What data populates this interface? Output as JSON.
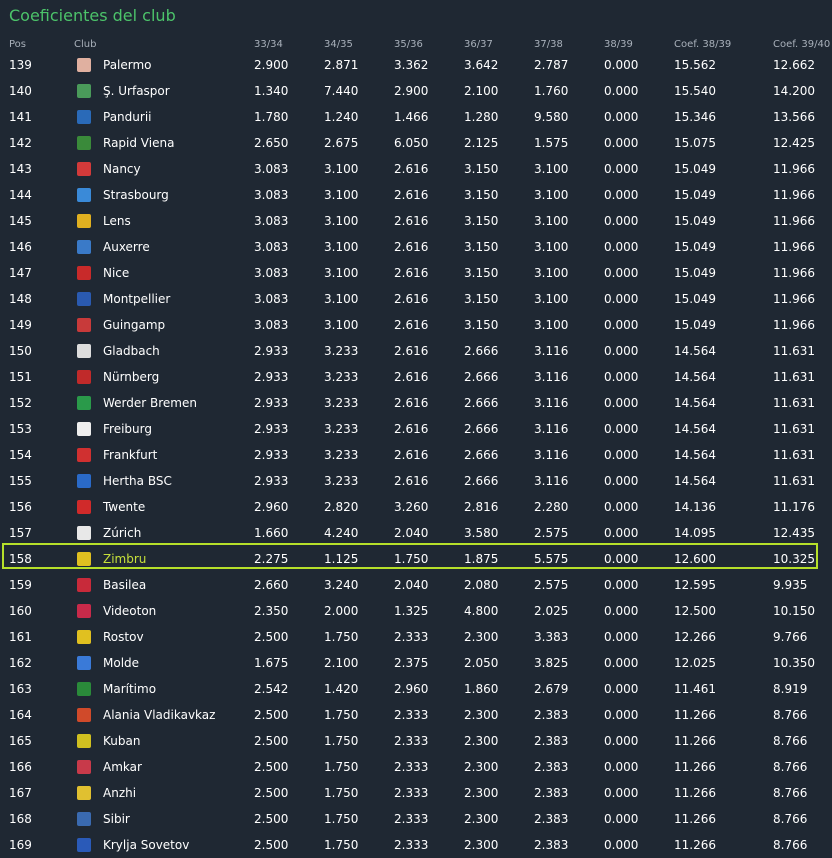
{
  "title": "Coeficientes del club",
  "headers": [
    "Pos",
    "Club",
    "33/34",
    "34/35",
    "35/36",
    "36/37",
    "37/38",
    "38/39",
    "Coef. 38/39",
    "Coef. 39/40"
  ],
  "colors": {
    "accent": "#4cc36a",
    "highlight": "#b6e02a",
    "background": "#1f2833"
  },
  "highlight_pos": "158",
  "rows": [
    {
      "pos": "139",
      "club": "Palermo",
      "badge": "#e0b0a0",
      "v": [
        "2.900",
        "2.871",
        "3.362",
        "3.642",
        "2.787",
        "0.000",
        "15.562",
        "12.662"
      ]
    },
    {
      "pos": "140",
      "club": "Ş. Urfaspor",
      "badge": "#4a9a5a",
      "v": [
        "1.340",
        "7.440",
        "2.900",
        "2.100",
        "1.760",
        "0.000",
        "15.540",
        "14.200"
      ]
    },
    {
      "pos": "141",
      "club": "Pandurii",
      "badge": "#2a6ab8",
      "v": [
        "1.780",
        "1.240",
        "1.466",
        "1.280",
        "9.580",
        "0.000",
        "15.346",
        "13.566"
      ]
    },
    {
      "pos": "142",
      "club": "Rapid Viena",
      "badge": "#3a8a3a",
      "v": [
        "2.650",
        "2.675",
        "6.050",
        "2.125",
        "1.575",
        "0.000",
        "15.075",
        "12.425"
      ]
    },
    {
      "pos": "143",
      "club": "Nancy",
      "badge": "#d23a3a",
      "v": [
        "3.083",
        "3.100",
        "2.616",
        "3.150",
        "3.100",
        "0.000",
        "15.049",
        "11.966"
      ]
    },
    {
      "pos": "144",
      "club": "Strasbourg",
      "badge": "#3a8ad8",
      "v": [
        "3.083",
        "3.100",
        "2.616",
        "3.150",
        "3.100",
        "0.000",
        "15.049",
        "11.966"
      ]
    },
    {
      "pos": "145",
      "club": "Lens",
      "badge": "#e0b020",
      "v": [
        "3.083",
        "3.100",
        "2.616",
        "3.150",
        "3.100",
        "0.000",
        "15.049",
        "11.966"
      ]
    },
    {
      "pos": "146",
      "club": "Auxerre",
      "badge": "#3a7ac8",
      "v": [
        "3.083",
        "3.100",
        "2.616",
        "3.150",
        "3.100",
        "0.000",
        "15.049",
        "11.966"
      ]
    },
    {
      "pos": "147",
      "club": "Nice",
      "badge": "#c82a2a",
      "v": [
        "3.083",
        "3.100",
        "2.616",
        "3.150",
        "3.100",
        "0.000",
        "15.049",
        "11.966"
      ]
    },
    {
      "pos": "148",
      "club": "Montpellier",
      "badge": "#2a5ab0",
      "v": [
        "3.083",
        "3.100",
        "2.616",
        "3.150",
        "3.100",
        "0.000",
        "15.049",
        "11.966"
      ]
    },
    {
      "pos": "149",
      "club": "Guingamp",
      "badge": "#c83a3a",
      "v": [
        "3.083",
        "3.100",
        "2.616",
        "3.150",
        "3.100",
        "0.000",
        "15.049",
        "11.966"
      ]
    },
    {
      "pos": "150",
      "club": "Gladbach",
      "badge": "#dddddd",
      "v": [
        "2.933",
        "3.233",
        "2.616",
        "2.666",
        "3.116",
        "0.000",
        "14.564",
        "11.631"
      ]
    },
    {
      "pos": "151",
      "club": "Nürnberg",
      "badge": "#c02a2a",
      "v": [
        "2.933",
        "3.233",
        "2.616",
        "2.666",
        "3.116",
        "0.000",
        "14.564",
        "11.631"
      ]
    },
    {
      "pos": "152",
      "club": "Werder Bremen",
      "badge": "#2a9a4a",
      "v": [
        "2.933",
        "3.233",
        "2.616",
        "2.666",
        "3.116",
        "0.000",
        "14.564",
        "11.631"
      ]
    },
    {
      "pos": "153",
      "club": "Freiburg",
      "badge": "#eeeeee",
      "v": [
        "2.933",
        "3.233",
        "2.616",
        "2.666",
        "3.116",
        "0.000",
        "14.564",
        "11.631"
      ]
    },
    {
      "pos": "154",
      "club": "Frankfurt",
      "badge": "#d03030",
      "v": [
        "2.933",
        "3.233",
        "2.616",
        "2.666",
        "3.116",
        "0.000",
        "14.564",
        "11.631"
      ]
    },
    {
      "pos": "155",
      "club": "Hertha BSC",
      "badge": "#2a6ac8",
      "v": [
        "2.933",
        "3.233",
        "2.616",
        "2.666",
        "3.116",
        "0.000",
        "14.564",
        "11.631"
      ]
    },
    {
      "pos": "156",
      "club": "Twente",
      "badge": "#d02a2a",
      "v": [
        "2.960",
        "2.820",
        "3.260",
        "2.816",
        "2.280",
        "0.000",
        "14.136",
        "11.176"
      ]
    },
    {
      "pos": "157",
      "club": "Zúrich",
      "badge": "#e8e8e8",
      "v": [
        "1.660",
        "4.240",
        "2.040",
        "3.580",
        "2.575",
        "0.000",
        "14.095",
        "12.435"
      ]
    },
    {
      "pos": "158",
      "club": "Zimbru",
      "badge": "#e0c020",
      "v": [
        "2.275",
        "1.125",
        "1.750",
        "1.875",
        "5.575",
        "0.000",
        "12.600",
        "10.325"
      ]
    },
    {
      "pos": "159",
      "club": "Basilea",
      "badge": "#c82a3a",
      "v": [
        "2.660",
        "3.240",
        "2.040",
        "2.080",
        "2.575",
        "0.000",
        "12.595",
        "9.935"
      ]
    },
    {
      "pos": "160",
      "club": "Videoton",
      "badge": "#c82a4a",
      "v": [
        "2.350",
        "2.000",
        "1.325",
        "4.800",
        "2.025",
        "0.000",
        "12.500",
        "10.150"
      ]
    },
    {
      "pos": "161",
      "club": "Rostov",
      "badge": "#e0c020",
      "v": [
        "2.500",
        "1.750",
        "2.333",
        "2.300",
        "3.383",
        "0.000",
        "12.266",
        "9.766"
      ]
    },
    {
      "pos": "162",
      "club": "Molde",
      "badge": "#3a7ad8",
      "v": [
        "1.675",
        "2.100",
        "2.375",
        "2.050",
        "3.825",
        "0.000",
        "12.025",
        "10.350"
      ]
    },
    {
      "pos": "163",
      "club": "Marítimo",
      "badge": "#2a8a3a",
      "v": [
        "2.542",
        "1.420",
        "2.960",
        "1.860",
        "2.679",
        "0.000",
        "11.461",
        "8.919"
      ]
    },
    {
      "pos": "164",
      "club": "Alania Vladikavkaz",
      "badge": "#d04a2a",
      "v": [
        "2.500",
        "1.750",
        "2.333",
        "2.300",
        "2.383",
        "0.000",
        "11.266",
        "8.766"
      ]
    },
    {
      "pos": "165",
      "club": "Kuban",
      "badge": "#d0c020",
      "v": [
        "2.500",
        "1.750",
        "2.333",
        "2.300",
        "2.383",
        "0.000",
        "11.266",
        "8.766"
      ]
    },
    {
      "pos": "166",
      "club": "Amkar",
      "badge": "#c83a4a",
      "v": [
        "2.500",
        "1.750",
        "2.333",
        "2.300",
        "2.383",
        "0.000",
        "11.266",
        "8.766"
      ]
    },
    {
      "pos": "167",
      "club": "Anzhi",
      "badge": "#e0c030",
      "v": [
        "2.500",
        "1.750",
        "2.333",
        "2.300",
        "2.383",
        "0.000",
        "11.266",
        "8.766"
      ]
    },
    {
      "pos": "168",
      "club": "Sibir",
      "badge": "#3a6ab0",
      "v": [
        "2.500",
        "1.750",
        "2.333",
        "2.300",
        "2.383",
        "0.000",
        "11.266",
        "8.766"
      ]
    },
    {
      "pos": "169",
      "club": "Krylja Sovetov",
      "badge": "#2a5ab8",
      "v": [
        "2.500",
        "1.750",
        "2.333",
        "2.300",
        "2.383",
        "0.000",
        "11.266",
        "8.766"
      ]
    }
  ]
}
